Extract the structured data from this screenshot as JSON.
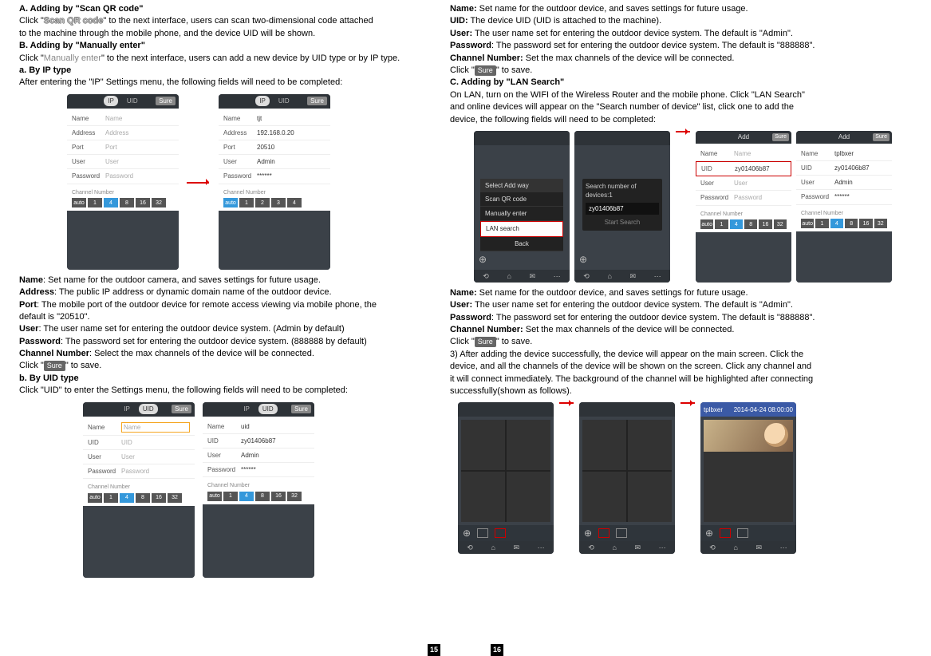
{
  "left": {
    "hA": "A. Adding by \"Scan QR code\"",
    "lineA1_a": "Click \"",
    "scanQR": "Scan QR code",
    "lineA1_b": "\" to the next interface, users can scan two-dimensional code attached",
    "lineA2": "to the machine through the mobile phone, and the device UID will be shown.",
    "hB": "B. Adding by \"Manually enter\"",
    "lineB1_a": "Click \"",
    "manual": "Manually enter",
    "lineB1_b": "\" to the next interface, users can add a new device by UID type or by IP type.",
    "hBa": "a. By IP type",
    "lineBa": "After entering the \"IP\" Settings menu, the following fields will need to be completed:",
    "ipForm1": {
      "tabs": [
        "IP",
        "UID"
      ],
      "sure": "Sure",
      "rows": [
        [
          "Name",
          "Name"
        ],
        [
          "Address",
          "Address"
        ],
        [
          "Port",
          "Port"
        ],
        [
          "User",
          "User"
        ],
        [
          "Password",
          "Password"
        ]
      ],
      "chn": "Channel Number",
      "nums": [
        "auto",
        "1",
        "4",
        "8",
        "16",
        "32"
      ]
    },
    "ipForm2": {
      "tabs": [
        "IP",
        "UID"
      ],
      "sure": "Sure",
      "rows": [
        [
          "Name",
          "tjt"
        ],
        [
          "Address",
          "192.168.0.20"
        ],
        [
          "Port",
          "20510"
        ],
        [
          "User",
          "Admin"
        ],
        [
          "Password",
          "******"
        ]
      ],
      "chn": "Channel Number",
      "nums": [
        "auto",
        "1",
        "2",
        "3",
        "4"
      ]
    },
    "desc": {
      "name_l": "Name",
      "name_t": ": Set name for the outdoor camera, and saves settings for future usage.",
      "addr_l": "Address",
      "addr_t": ": The public IP address or dynamic domain name of the outdoor device.",
      "port_l": "Port",
      "port_t": ": The mobile port of the outdoor device  for remote access viewing via mobile phone, the",
      "port_t2": "default is \"20510\".",
      "user_l": "User",
      "user_t": ": The user name set for entering the outdoor device system. (Admin by default)",
      "pass_l": "Password",
      "pass_t": ": The password set for entering the outdoor device system. (888888 by default)",
      "chn_l": "Channel Number",
      "chn_t": ": Select the max channels of the device will be connected.",
      "click_a": "Click \"",
      "sure": "Sure",
      "click_b": "\" to save."
    },
    "hBb": "b. By UID type",
    "lineBb": "Click \"UID\" to enter the Settings menu, the following fields will need to be completed:",
    "uidForm1": {
      "tabs": [
        "IP",
        "UID"
      ],
      "sure": "Sure",
      "rows": [
        [
          "Name",
          "Name"
        ],
        [
          "UID",
          "UID"
        ],
        [
          "User",
          "User"
        ],
        [
          "Password",
          "Password"
        ]
      ],
      "chn": "Channel Number",
      "nums": [
        "auto",
        "1",
        "4",
        "8",
        "16",
        "32"
      ]
    },
    "uidForm2": {
      "tabs": [
        "IP",
        "UID"
      ],
      "sure": "Sure",
      "rows": [
        [
          "Name",
          "uid"
        ],
        [
          "UID",
          "zy01406b87"
        ],
        [
          "User",
          "Admin"
        ],
        [
          "Password",
          "******"
        ]
      ],
      "chn": "Channel Number",
      "nums": [
        "auto",
        "1",
        "4",
        "8",
        "16",
        "32"
      ]
    },
    "pageNum": "15"
  },
  "right": {
    "top": {
      "name_l": "Name:",
      "name_t": " Set name for the outdoor device, and saves settings for future usage.",
      "uid_l": "UID:",
      "uid_t": " The device UID (UID is attached to the machine).",
      "user_l": "User:",
      "user_t": " The user name set for entering the outdoor device system. The default is \"Admin\".",
      "pass_l": "Password",
      "pass_t": ": The password set for entering the outdoor device system. The default is \"888888\".",
      "chn_l": "Channel Number:",
      "chn_t": " Set the max channels of the device will be connected.",
      "click_a": "Click \"",
      "sure": "Sure",
      "click_b": "\" to save."
    },
    "hC": "C. Adding by \"LAN Search\"",
    "cTxt1": "On LAN, turn on the WIFI of the Wireless Router and the mobile phone. Click \"LAN Search\"",
    "cTxt2": "and online devices will appear on the \"Search number of device\" list, click one to add the",
    "cTxt3": "device, the following fields will need to be completed:",
    "lanMenu": {
      "hdr": "Select Add way",
      "items": [
        "Scan QR code",
        "Manually enter",
        "LAN search"
      ],
      "back": "Back"
    },
    "searchBox": {
      "title": "Search number of devices:1",
      "uid": "zy01406b87",
      "btn": "Start Search"
    },
    "addForm1": {
      "title": "Add",
      "sure": "Sure",
      "rows": [
        [
          "Name",
          "Name"
        ],
        [
          "UID",
          "zy01406b87"
        ],
        [
          "User",
          "User"
        ],
        [
          "Password",
          "Password"
        ]
      ],
      "chn": "Channel Number",
      "nums": [
        "auto",
        "1",
        "4",
        "8",
        "16",
        "32"
      ]
    },
    "addForm2": {
      "title": "Add",
      "sure": "Sure",
      "rows": [
        [
          "Name",
          "tplbxer"
        ],
        [
          "UID",
          "zy01406b87"
        ],
        [
          "User",
          "Admin"
        ],
        [
          "Password",
          "******"
        ]
      ],
      "chn": "Channel Number",
      "nums": [
        "auto",
        "1",
        "4",
        "8",
        "16",
        "32"
      ]
    },
    "mid": {
      "name_l": "Name:",
      "name_t": " Set name for the outdoor device, and saves settings for future usage.",
      "user_l": "User:",
      "user_t": " The user name set for entering the outdoor device system. The default is \"Admin\".",
      "pass_l": "Password",
      "pass_t": ": The password set for entering the outdoor device system. The default is \"888888\".",
      "chn_l": "Channel Number:",
      "chn_t": " Set the max channels of the device will be connected.",
      "click_a": "Click \"",
      "sure": "Sure",
      "click_b": "\" to save.",
      "three": "3) After adding the device successfully, the device will appear on the main screen. Click the",
      "three2": "device, and all the channels of the device will be shown on the screen. Click any channel and",
      "three3": "it will connect immediately. The background of the channel will be highlighted after connecting",
      "three4": "successfully(shown as follows)."
    },
    "liveHeader": {
      "title": "tplbxer",
      "time": "2014-04-24 08:00:00"
    },
    "plus": "⊕",
    "bottomIcons": [
      "⟲",
      "⌂",
      "✉",
      "⋯"
    ],
    "pageNum": "16"
  }
}
